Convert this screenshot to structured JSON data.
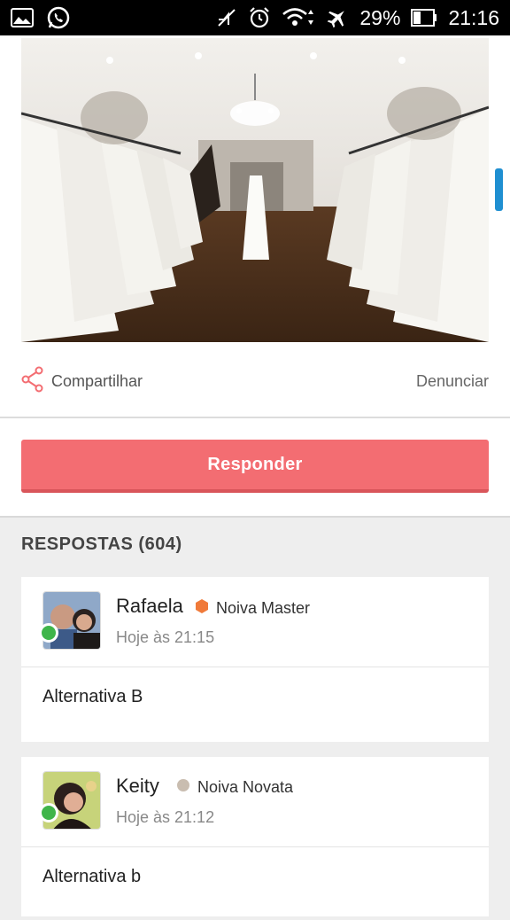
{
  "status_bar": {
    "battery": "29%",
    "time": "21:16"
  },
  "post": {
    "share_label": "Compartilhar",
    "report_label": "Denunciar",
    "reply_button": "Responder"
  },
  "answers": {
    "title": "RESPOSTAS (604)",
    "items": [
      {
        "name": "Rafaela",
        "rank": "Noiva Master",
        "rank_color": "#f07a3a",
        "time": "Hoje às 21:15",
        "text": "Alternativa B"
      },
      {
        "name": "Keity",
        "rank": "Noiva Novata",
        "rank_color": "#c9bdb0",
        "time": "Hoje às 21:12",
        "text": "Alternativa b"
      }
    ]
  }
}
